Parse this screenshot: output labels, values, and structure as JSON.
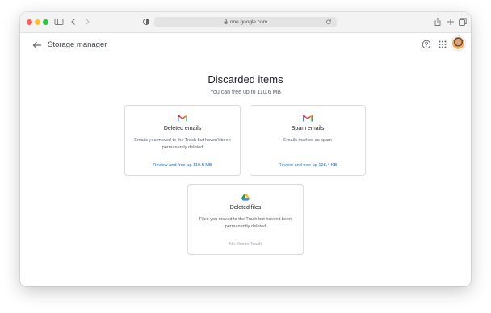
{
  "browser": {
    "url": "one.google.com"
  },
  "appbar": {
    "title": "Storage manager"
  },
  "main": {
    "heading": "Discarded items",
    "subheading": "You can free up to 110.6 MB",
    "cards": [
      {
        "icon": "gmail-icon",
        "title": "Deleted emails",
        "description": "Emails you moved to the Trash but haven't been permanently deleted",
        "action": "Review and free up 110.5 MB"
      },
      {
        "icon": "gmail-icon",
        "title": "Spam emails",
        "description": "Emails marked as spam",
        "action": "Review and free up 128.4 KB"
      },
      {
        "icon": "google-drive-icon",
        "title": "Deleted files",
        "description": "Files you moved to the Trash but haven't been permanently deleted",
        "action": "No files in Trash"
      }
    ]
  },
  "colors": {
    "link": "#1a73e8",
    "muted": "#a0a4a8"
  }
}
